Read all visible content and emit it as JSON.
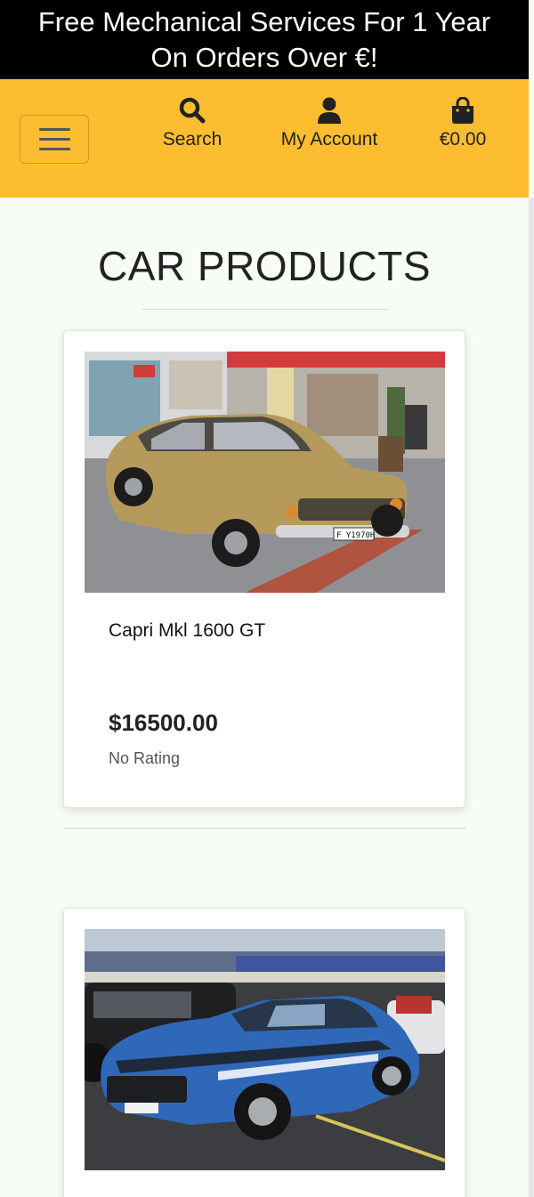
{
  "promo": {
    "line1": "Free Mechanical Services For 1 Year",
    "line2": "On Orders Over €!"
  },
  "nav": {
    "menu_icon": "hamburger-icon",
    "search_label": "Search",
    "search_icon": "search-icon",
    "account_label": "My Account",
    "account_icon": "user-icon",
    "bag_total": "€0.00",
    "bag_icon": "shopping-bag-icon",
    "accent_color": "#fdbd31"
  },
  "page": {
    "title": "CAR PRODUCTS"
  },
  "products": [
    {
      "name": "Capri Mkl 1600 GT",
      "price": "$16500.00",
      "rating": "No Rating",
      "image_alt": "Gold Ford Capri parked on a cobblestone street",
      "plate": "F Y1970H"
    },
    {
      "image_alt": "Blue Ford Mustang with white stripe at a car show"
    }
  ]
}
